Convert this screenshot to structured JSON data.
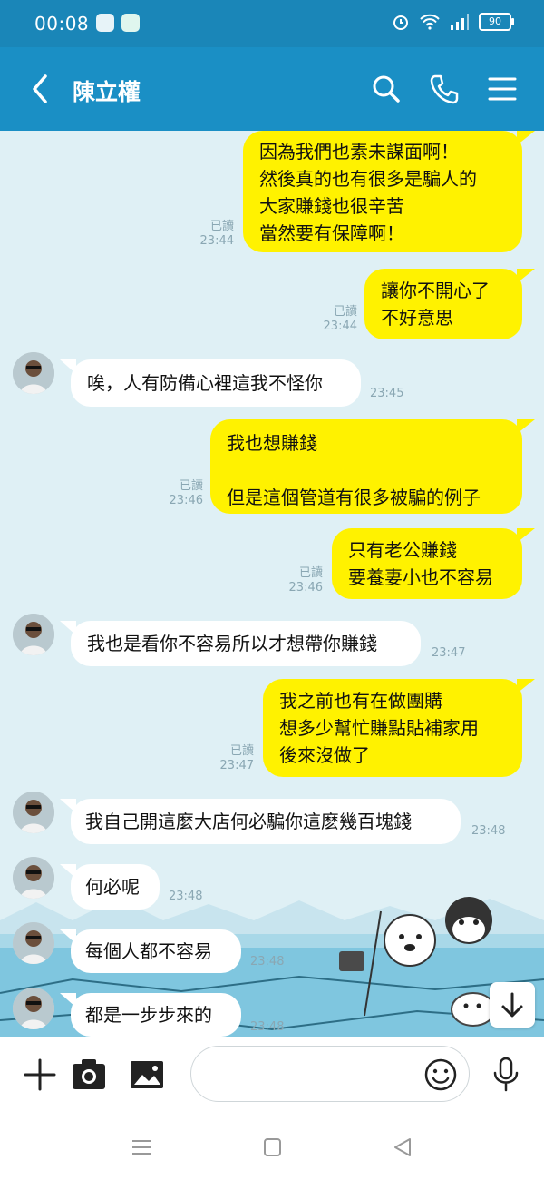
{
  "status_bar": {
    "time": "00:08",
    "battery": "90"
  },
  "header": {
    "contact_name": "陳立權"
  },
  "messages": [
    {
      "dir": "out",
      "text": "因為我們也素未謀面啊！\n然後真的也有很多是騙人的\n大家賺錢也很辛苦\n當然要有保障啊！",
      "read": "已讀",
      "time": "23:44"
    },
    {
      "dir": "out",
      "text": "讓你不開心了\n不好意思",
      "read": "已讀",
      "time": "23:44"
    },
    {
      "dir": "in",
      "text": "唉，人有防備心裡這我不怪你",
      "time": "23:45"
    },
    {
      "dir": "out",
      "text": "我也想賺錢\n\n但是這個管道有很多被騙的例子",
      "read": "已讀",
      "time": "23:46"
    },
    {
      "dir": "out",
      "text": "只有老公賺錢\n要養妻小也不容易",
      "read": "已讀",
      "time": "23:46"
    },
    {
      "dir": "in",
      "text": "我也是看你不容易所以才想帶你賺錢",
      "time": "23:47"
    },
    {
      "dir": "out",
      "text": "我之前也有在做團購\n想多少幫忙賺點貼補家用\n後來沒做了",
      "read": "已讀",
      "time": "23:47"
    },
    {
      "dir": "in",
      "text": "我自己開這麼大店何必騙你這麽幾百塊錢",
      "time": "23:48"
    },
    {
      "dir": "in",
      "text": "何必呢",
      "time": "23:48"
    },
    {
      "dir": "in",
      "text": "每個人都不容易",
      "time": "23:48"
    },
    {
      "dir": "in",
      "text": "都是一步步來的",
      "time": "23:48"
    }
  ],
  "input": {
    "placeholder": ""
  },
  "colors": {
    "header": "#1a8fc5",
    "status_bar": "#1a86b8",
    "outgoing_bubble": "#fff200",
    "incoming_bubble": "#ffffff",
    "chat_bg": "#dff0f5"
  },
  "icons": [
    "back-arrow-icon",
    "search-icon",
    "phone-icon",
    "menu-icon",
    "plus-icon",
    "camera-icon",
    "image-icon",
    "emoji-icon",
    "microphone-icon",
    "scroll-down-icon"
  ]
}
